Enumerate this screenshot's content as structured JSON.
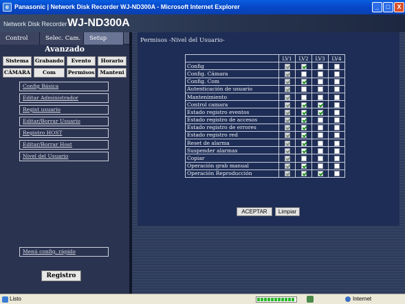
{
  "window": {
    "title": "Panasonic | Network Disk Recorder WJ-ND300A - Microsoft Internet Explorer",
    "min_label": "_",
    "max_label": "□",
    "close_label": "X"
  },
  "app": {
    "subtitle": "Network Disk Recorder",
    "model": "WJ-ND300A"
  },
  "sidebar": {
    "tabs": [
      {
        "label": "Control"
      },
      {
        "label": "Selec. Cam."
      },
      {
        "label": "Setup"
      }
    ],
    "section_title": "Avanzado",
    "nav_buttons": [
      {
        "label": "Sistema"
      },
      {
        "label": "Grabando"
      },
      {
        "label": "Evento"
      },
      {
        "label": "Horario"
      },
      {
        "label": "CÁMARA"
      },
      {
        "label": "Com"
      },
      {
        "label": "Permisos"
      },
      {
        "label": "Manteni"
      }
    ],
    "menu": [
      {
        "label": "Config Básica"
      },
      {
        "label": "Editar Administrador"
      },
      {
        "label": "Regist usuario"
      },
      {
        "label": "Editar/Borrar Usuario"
      },
      {
        "label": "Registro HOST"
      },
      {
        "label": "Editar/Borrar Host"
      },
      {
        "label": "Nivel del Usuario"
      }
    ],
    "quick_menu": "Menú config. rápido",
    "registro_button": "Registro"
  },
  "main": {
    "breadcrumb": "Permisos -Nivel del Usuario-",
    "levels": [
      "LV1",
      "LV2",
      "LV3",
      "LV4"
    ],
    "rows": [
      {
        "label": "Config",
        "checks": [
          true,
          true,
          false,
          false
        ]
      },
      {
        "label": "Config. Cámara",
        "checks": [
          true,
          false,
          false,
          false
        ]
      },
      {
        "label": "Config. Com",
        "checks": [
          true,
          true,
          false,
          false
        ]
      },
      {
        "label": "Autenticación de usuario",
        "checks": [
          true,
          false,
          false,
          false
        ]
      },
      {
        "label": "Mantenimiento",
        "checks": [
          true,
          false,
          false,
          false
        ]
      },
      {
        "label": "Control camara",
        "checks": [
          true,
          true,
          true,
          false
        ]
      },
      {
        "label": "Estado registro eventos",
        "checks": [
          true,
          true,
          true,
          false
        ]
      },
      {
        "label": "Estado registro de accesos",
        "checks": [
          true,
          true,
          false,
          false
        ]
      },
      {
        "label": "Estado registro de errores",
        "checks": [
          true,
          true,
          false,
          false
        ]
      },
      {
        "label": "Estado registro red",
        "checks": [
          true,
          true,
          false,
          false
        ]
      },
      {
        "label": "Reset de alarma",
        "checks": [
          true,
          true,
          false,
          false
        ]
      },
      {
        "label": "Suspender alarmas",
        "checks": [
          true,
          true,
          false,
          false
        ]
      },
      {
        "label": "Copiar",
        "checks": [
          true,
          false,
          false,
          false
        ]
      },
      {
        "label": "Operación grab manual",
        "checks": [
          true,
          true,
          false,
          false
        ]
      },
      {
        "label": "Operación Reproducción",
        "checks": [
          true,
          true,
          true,
          false
        ]
      }
    ],
    "accept_button": "ACEPTAR",
    "clear_button": "Limpiar"
  },
  "statusbar": {
    "status": "Listo",
    "zone": "Internet",
    "progress_fraction": 0.95
  }
}
